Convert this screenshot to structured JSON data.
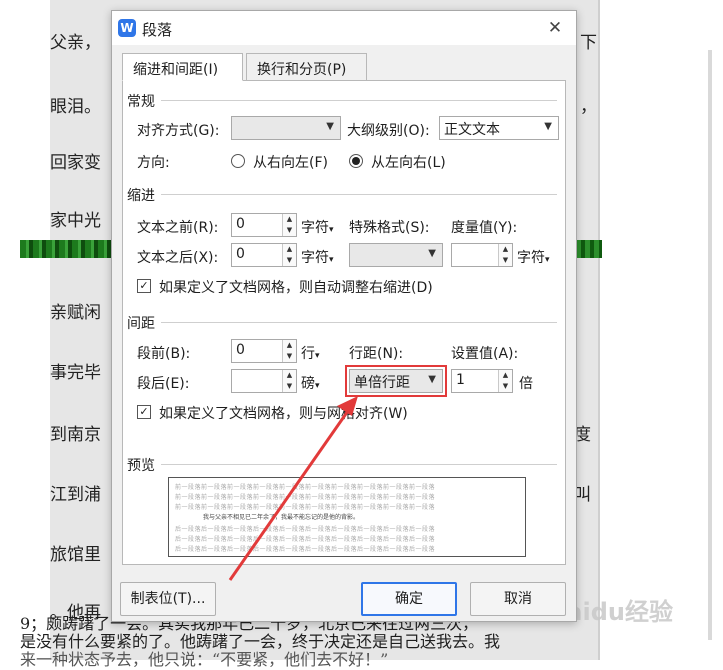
{
  "document": {
    "lines": [
      "父亲，",
      "眼泪。",
      "回家变",
      "家中光",
      "亲赋闲",
      "事完毕",
      "到南京",
      "江到浦",
      "旅馆里",
      "。他再"
    ],
    "bottom_line_1": "9；颇踌躇了一会。其实我那年已二十岁，北京已来往过两三次，",
    "bottom_line_2": "是没有什么要紧的了。他踌躇了一会，终于决定还是自己送我去。我",
    "bottom_line_3": "来一种状态予去，他只说：“不要紧，他们去不好！”",
    "right_fragments": [
      "下",
      "，",
      "度",
      "叫"
    ],
    "para_mark": "↵",
    "watermark": "Baidu经验"
  },
  "dialog": {
    "title": "段落",
    "app_icon_letter": "W",
    "close_glyph": "✕",
    "tabs": [
      {
        "label": "缩进和间距(I)",
        "active": true
      },
      {
        "label": "换行和分页(P)",
        "active": false
      }
    ],
    "general": {
      "title": "常规",
      "alignment_label": "对齐方式(G):",
      "alignment_value": "",
      "outline_label": "大纲级别(O):",
      "outline_value": "正文文本",
      "direction_label": "方向:",
      "rtl_label": "从右向左(F)",
      "ltr_label": "从左向右(L)",
      "direction_selected": "从左向右(L)"
    },
    "indent": {
      "title": "缩进",
      "before_label": "文本之前(R):",
      "before_value": "0",
      "before_unit": "字符",
      "after_label": "文本之后(X):",
      "after_value": "0",
      "after_unit": "字符",
      "special_label": "特殊格式(S):",
      "special_value": "",
      "measure_label": "度量值(Y):",
      "measure_value": "",
      "measure_unit": "字符",
      "auto_adjust_label": "如果定义了文档网格，则自动调整右缩进(D)",
      "auto_adjust_checked": true
    },
    "spacing": {
      "title": "间距",
      "before_label": "段前(B):",
      "before_value": "0",
      "before_unit": "行",
      "after_label": "段后(E):",
      "after_value": "",
      "after_unit": "磅",
      "line_label": "行距(N):",
      "line_value": "单倍行距",
      "setting_label": "设置值(A):",
      "setting_value": "1",
      "setting_unit": "倍",
      "snap_grid_label": "如果定义了文档网格，则与网格对齐(W)",
      "snap_grid_checked": true
    },
    "preview": {
      "title": "预览",
      "prev_text": "前一段落前一段落前一段落前一段落前一段落前一段落前一段落前一段落前一段落前一段落",
      "main_text": "我与父亲不相见已二年余了，我最不能忘记的是他的背影。",
      "next_text": "后一段落后一段落后一段落后一段落后一段落后一段落后一段落后一段落后一段落后一段落"
    },
    "buttons": {
      "tabs_label": "制表位(T)...",
      "ok_label": "确定",
      "cancel_label": "取消"
    }
  },
  "colors": {
    "accent": "#2f76e8",
    "annotation": "#e23a3a"
  }
}
